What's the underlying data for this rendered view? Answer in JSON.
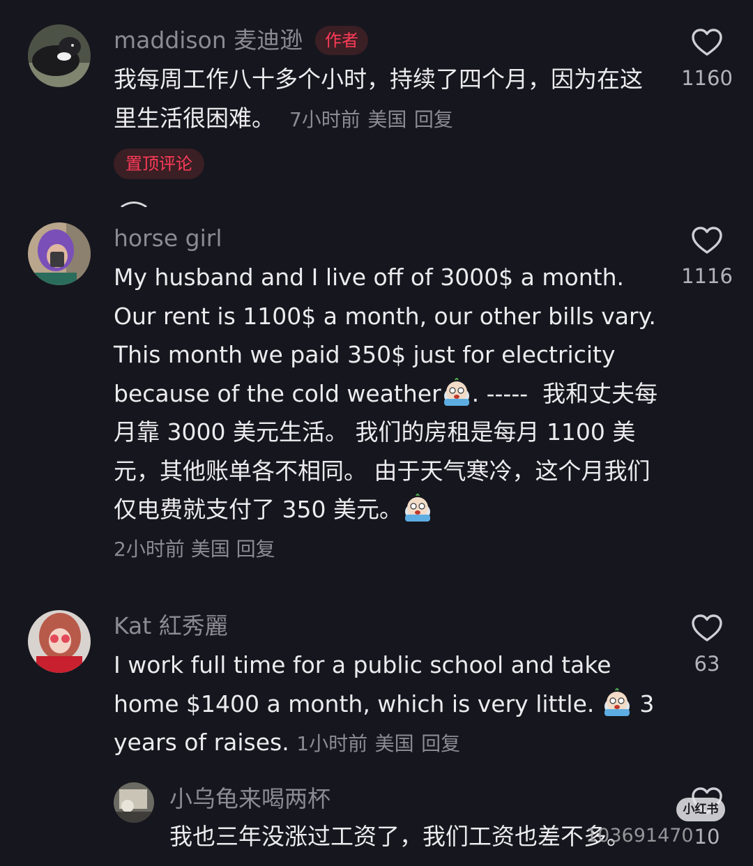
{
  "comments": [
    {
      "username": "maddison 麦迪逊",
      "tag": "作者",
      "text": "我每周工作八十多个小时，持续了四个月，因为在这里生活很困难。",
      "time": "7小时前",
      "location": "美国",
      "reply": "回复",
      "pinned_label": "置顶评论",
      "likes": "1160"
    },
    {
      "username": "horse girl",
      "text_en": "My husband and I live off of 3000$ a month. Our rent is 1100$ a month, our other bills vary. This month we paid 350$ just for electricity because of the cold weather",
      "text_sep": ". -----",
      "text_zh": "我和丈夫每月靠 3000 美元生活。 我们的房租是每月 1100 美元，其他账单各不相同。 由于天气寒冷，这个月我们仅电费就支付了 350 美元。",
      "time": "2小时前",
      "location": "美国",
      "reply": "回复",
      "likes": "1116"
    },
    {
      "username": "Kat 紅秀麗",
      "text_a": "I work full time for a public school and take home $1400 a month, which is very little.",
      "text_b": "3 years of raises.",
      "time": "1小时前",
      "location": "美国",
      "reply": "回复",
      "likes": "63"
    },
    {
      "username": "小乌龟来喝两杯",
      "text": "我也三年没涨过工资了，我们工资也差不多。",
      "likes": "10"
    }
  ],
  "watermark": {
    "logo": "小红书",
    "id": "103691470"
  },
  "icons": {
    "like": "heart-outline-icon",
    "emoji": "crying-face-emoji-icon"
  }
}
